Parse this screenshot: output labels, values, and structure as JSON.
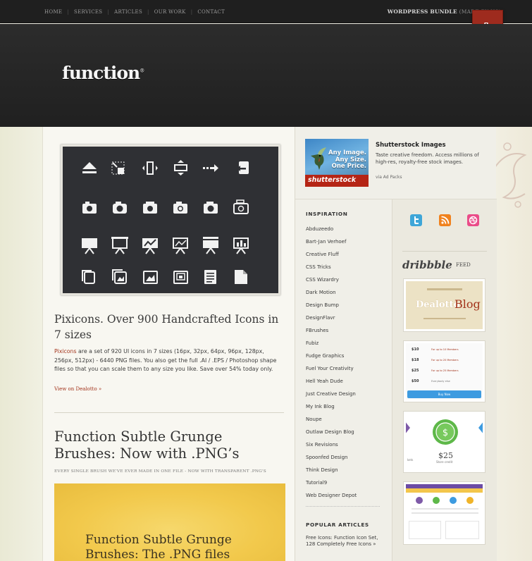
{
  "nav": {
    "items": [
      "HOME",
      "SERVICES",
      "ARTICLES",
      "OUR WORK",
      "CONTACT"
    ],
    "bundle": "WORDPRESS BUNDLE",
    "bundle_note": "(MADE BY US)",
    "ribbon_icon": "hand-pointer-icon"
  },
  "header": {
    "logo": "function",
    "logo_mark": "®"
  },
  "post1": {
    "title": "Pixicons. Over 900 Handcrafted Icons in 7 sizes",
    "body_link": "Pixicons",
    "body": " are a set of 920 UI icons in 7 sizes (16px, 32px, 64px, 96px, 128px, 256px, 512px) - 6440 PNG files. You also get the full .AI / .EPS / Photoshop shape files so that you can scale them to any size you like. Save over 54% today only.",
    "link": "View on Dealotto »"
  },
  "post2": {
    "title": "Function Subtle Grunge Brushes: Now with .PNG’s",
    "subtitle": "EVERY SINGLE BRUSH WE'VE EVER MADE IN ONE FILE - NOW WITH TRANSPARENT .PNG'S",
    "image_title_1": "Function Subtle Grunge",
    "image_title_2": "Brushes: The .PNG files"
  },
  "ad": {
    "line1": "Any Image.",
    "line2": "Any Size.",
    "line3": "One Price.",
    "brand": "shutterstock",
    "title": "Shutterstock Images",
    "desc": "Taste creative freedom. Access millions of high-res, royalty-free stock images.",
    "via": "via Ad Packs"
  },
  "sidebar": {
    "inspiration_heading": "INSPIRATION",
    "items": [
      "Abduzeedo",
      "Bart-Jan Verhoef",
      "Creative Fluff",
      "CSS Tricks",
      "CSS Wizardry",
      "Dark Motion",
      "Design Bump",
      "DesignFlavr",
      "FBrushes",
      "Fubiz",
      "Fudge Graphics",
      "Fuel Your Creativity",
      "Hell Yeah Dude",
      "Just Creative Design",
      "My Ink Blog",
      "Noupe",
      "Outlaw Design Blog",
      "Six Revisions",
      "Spoonfed Design",
      "Think Design",
      "Tutorial9",
      "Web Designer Depot"
    ],
    "popular_heading": "POPULAR ARTICLES",
    "popular_item": "Free Icons: Function Icon Set, 128 Completely Free Icons »"
  },
  "social": {
    "icons": [
      "twitter-icon",
      "rss-icon",
      "dribbble-icon"
    ],
    "colors": [
      "#3ea6d8",
      "#f0821e",
      "#ea4c89"
    ]
  },
  "dribbble": {
    "logo": "dribbble",
    "feed": "FEED",
    "shot1_brand": "Dealotto",
    "shot1_word": "Blog",
    "shot2_rows": [
      [
        "$10",
        "For up to 10 Members"
      ],
      [
        "$18",
        "For up to 20 Members"
      ],
      [
        "$25",
        "For up to 25 Members"
      ],
      [
        "$50",
        "Everybody else"
      ]
    ],
    "shot2_button": "Buy Now",
    "shot3_price": "$25",
    "shot3_note": "Store credit",
    "shot3_side": "kets"
  },
  "colors": {
    "accent": "#a2321a",
    "nav_bg": "#1f1f1f",
    "header_bg": "#262626",
    "ribbon": "#9e2b1e"
  }
}
